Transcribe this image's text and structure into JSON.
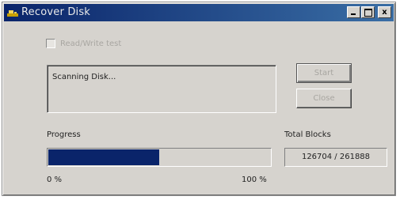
{
  "window": {
    "title": "Recover Disk",
    "icon": "app-icon",
    "controls": {
      "minimize": "minimize-icon",
      "maximize": "maximize-icon",
      "close_label": "x"
    }
  },
  "options": {
    "checkbox_label": "Read/Write test",
    "checked": false,
    "enabled": false
  },
  "status": {
    "text": "Scanning Disk..."
  },
  "buttons": {
    "start_label": "Start",
    "close_label": "Close"
  },
  "progress": {
    "label": "Progress",
    "min_label": "0 %",
    "max_label": "100 %",
    "fraction": 0.5
  },
  "blocks": {
    "label": "Total Blocks",
    "value": "126704 / 261888"
  },
  "colors": {
    "titlebar": "#0a246a",
    "progress_fill": "#0a246a",
    "face": "#d6d3ce"
  }
}
